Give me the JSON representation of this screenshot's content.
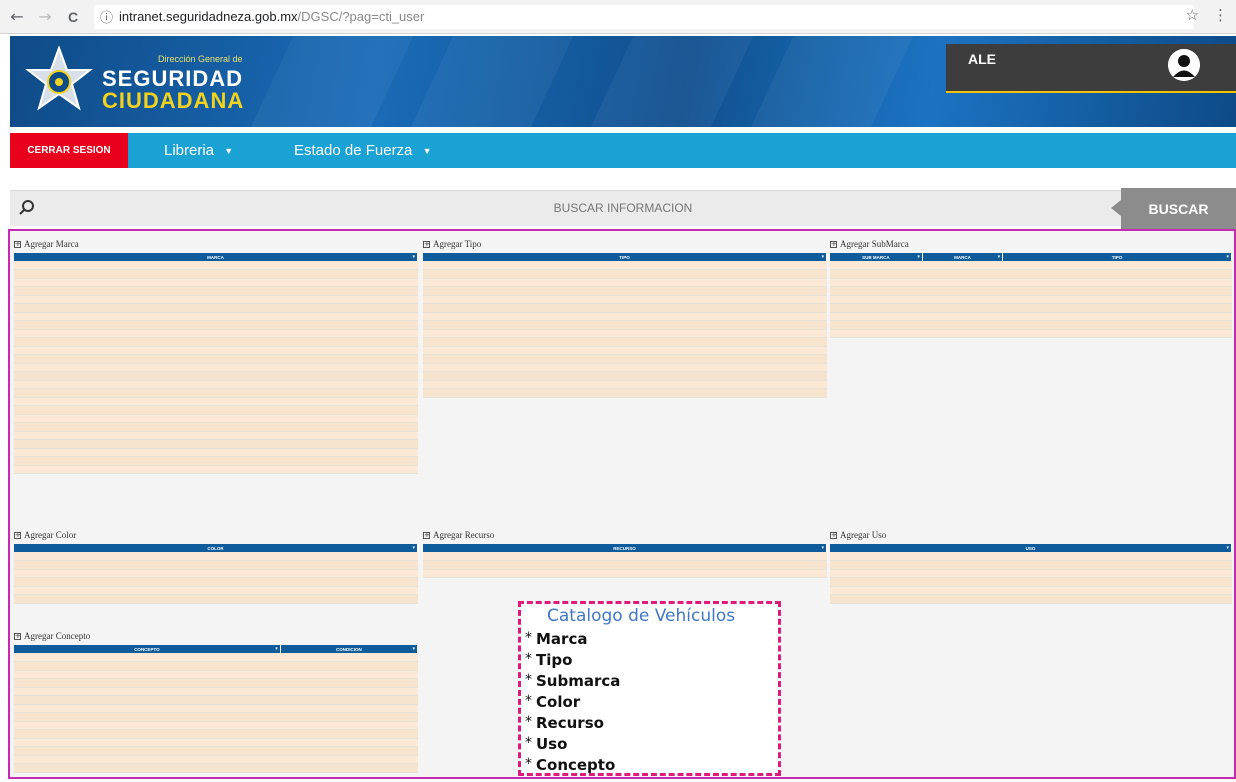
{
  "browser": {
    "back": "←",
    "forward": "→",
    "reload": "C",
    "info": "ⓘ",
    "url_host": "intranet.seguridadneza.gob.mx",
    "url_path": "/DGSC/?pag=cti_user",
    "star": "☆",
    "menu": "⋮"
  },
  "header": {
    "logo_small": "Dirección General de",
    "logo_line1": "SEGURIDAD",
    "logo_line2": "CIUDADANA",
    "user_name": "ALE"
  },
  "nav": {
    "logout": "CERRAR SESION",
    "items": [
      {
        "label": "Libreria",
        "caret": "▼"
      },
      {
        "label": "Estado de Fuerza",
        "caret": "▼"
      }
    ]
  },
  "search": {
    "label": "BUSCAR INFORMACION",
    "button": "BUSCAR"
  },
  "panels": {
    "marca": {
      "title": "Agregar Marca",
      "columns": [
        "MARCA"
      ]
    },
    "tipo": {
      "title": "Agregar Tipo",
      "columns": [
        "TIPO"
      ]
    },
    "submarca": {
      "title": "Agregar SubMarca",
      "columns": [
        "SUB MARCA",
        "MARCA",
        "TIPO"
      ]
    },
    "color": {
      "title": "Agregar Color",
      "columns": [
        "COLOR"
      ]
    },
    "recurso": {
      "title": "Agregar Recurso",
      "columns": [
        "RECURSO"
      ]
    },
    "uso": {
      "title": "Agregar Uso",
      "columns": [
        "USO"
      ]
    },
    "concepto": {
      "title": "Agregar Concepto",
      "columns": [
        "CONCEPTO",
        "CONDICION"
      ]
    }
  },
  "annotation": {
    "title": "Catalogo de Vehículos",
    "items": [
      "Marca",
      "Tipo",
      "Submarca",
      "Color",
      "Recurso",
      "Uso",
      "Concepto"
    ]
  },
  "colors": {
    "accent_border": "#c72ab2",
    "navbar": "#1aa2d4",
    "logout": "#e8001c",
    "table_header": "#0e5c9c",
    "annotation_border": "#e0197d"
  }
}
